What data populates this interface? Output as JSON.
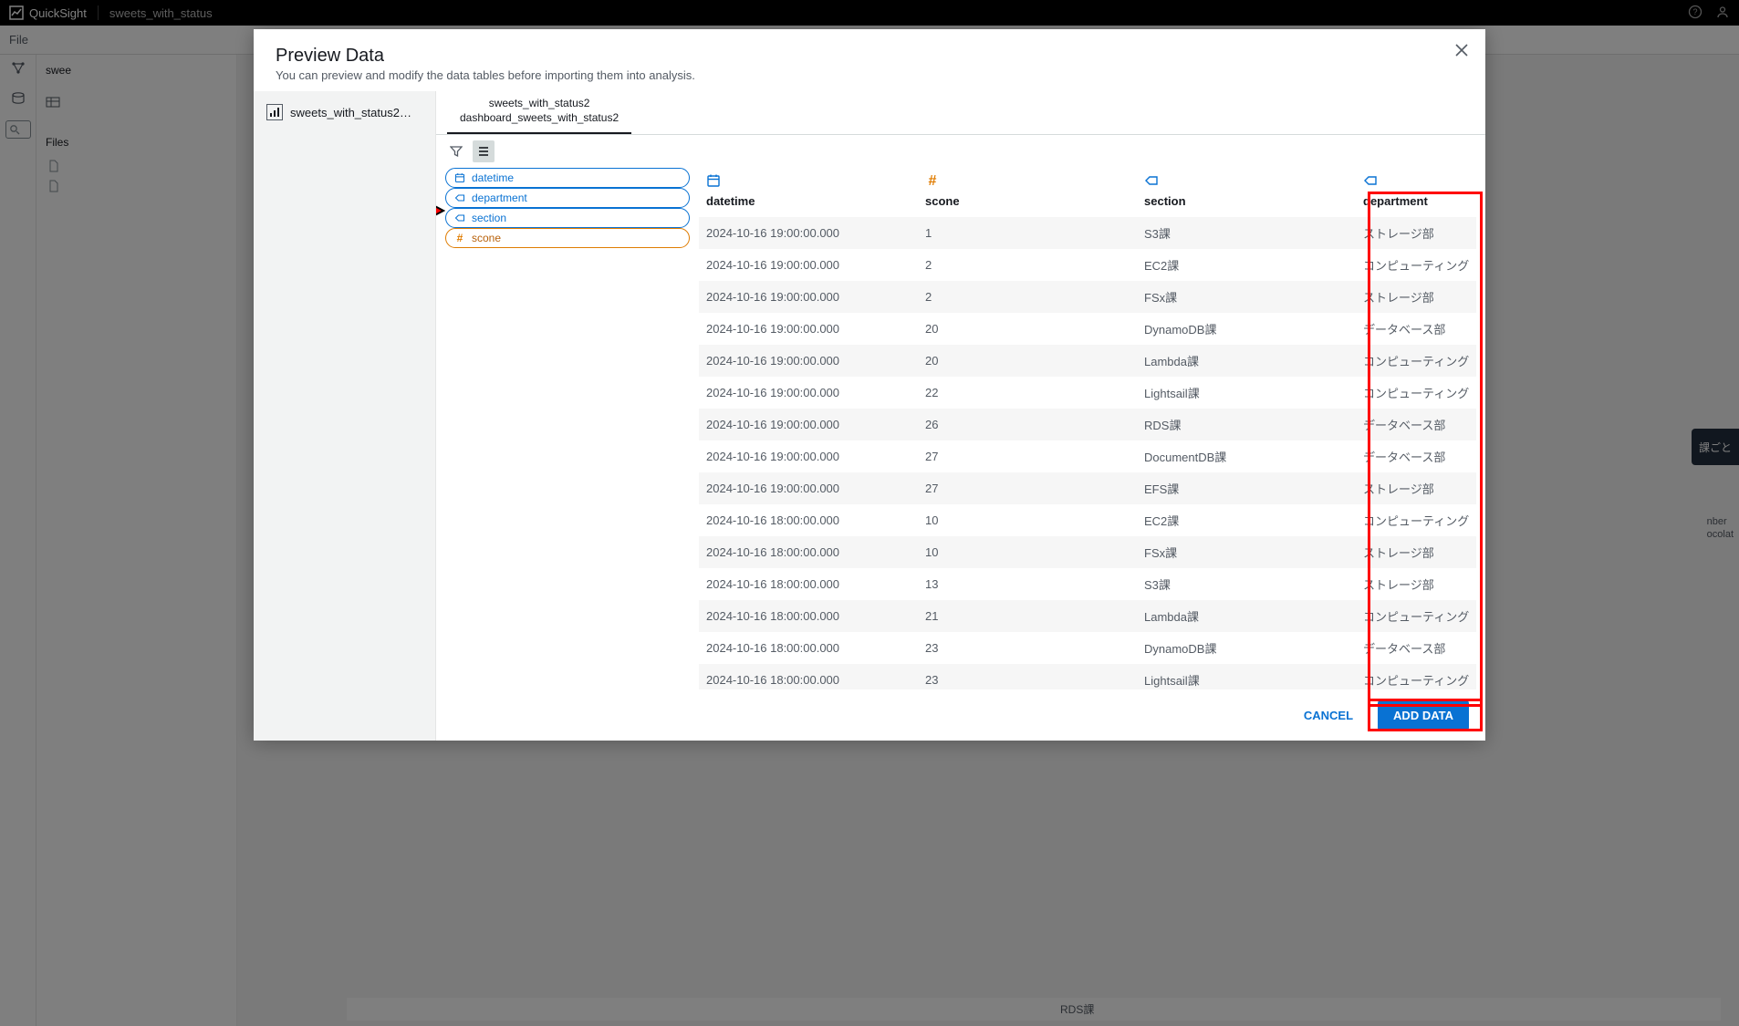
{
  "topbar": {
    "brand": "QuickSight",
    "doc": "sweets_with_status"
  },
  "subbar": {
    "file_label": "File"
  },
  "bg_sidebar": {
    "title_peek": "swee",
    "files_header": "Files",
    "files": [
      "",
      ""
    ]
  },
  "modal": {
    "title": "Preview Data",
    "subtitle": "You can preview and modify the data tables before importing them into analysis.",
    "close_aria": "Close",
    "left_ds_label": "sweets_with_status2…",
    "tab": {
      "line1": "sweets_with_status2",
      "line2": "dashboard_sweets_with_status2"
    },
    "pills": [
      {
        "kind": "date",
        "label": "datetime"
      },
      {
        "kind": "dim",
        "label": "department"
      },
      {
        "kind": "dim",
        "label": "section"
      },
      {
        "kind": "meas",
        "label": "scone"
      }
    ],
    "columns": [
      {
        "key": "datetime",
        "type": "date",
        "label": "datetime"
      },
      {
        "key": "scone",
        "type": "number",
        "label": "scone"
      },
      {
        "key": "section",
        "type": "dim",
        "label": "section"
      },
      {
        "key": "department",
        "type": "dim",
        "label": "department"
      }
    ],
    "rows": [
      {
        "datetime": "2024-10-16 19:00:00.000",
        "scone": "1",
        "section": "S3課",
        "department": "ストレージ部"
      },
      {
        "datetime": "2024-10-16 19:00:00.000",
        "scone": "2",
        "section": "EC2課",
        "department": "コンピューティング"
      },
      {
        "datetime": "2024-10-16 19:00:00.000",
        "scone": "2",
        "section": "FSx課",
        "department": "ストレージ部"
      },
      {
        "datetime": "2024-10-16 19:00:00.000",
        "scone": "20",
        "section": "DynamoDB課",
        "department": "データベース部"
      },
      {
        "datetime": "2024-10-16 19:00:00.000",
        "scone": "20",
        "section": "Lambda課",
        "department": "コンピューティング"
      },
      {
        "datetime": "2024-10-16 19:00:00.000",
        "scone": "22",
        "section": "Lightsail課",
        "department": "コンピューティング"
      },
      {
        "datetime": "2024-10-16 19:00:00.000",
        "scone": "26",
        "section": "RDS課",
        "department": "データベース部"
      },
      {
        "datetime": "2024-10-16 19:00:00.000",
        "scone": "27",
        "section": "DocumentDB課",
        "department": "データベース部"
      },
      {
        "datetime": "2024-10-16 19:00:00.000",
        "scone": "27",
        "section": "EFS課",
        "department": "ストレージ部"
      },
      {
        "datetime": "2024-10-16 18:00:00.000",
        "scone": "10",
        "section": "EC2課",
        "department": "コンピューティング"
      },
      {
        "datetime": "2024-10-16 18:00:00.000",
        "scone": "10",
        "section": "FSx課",
        "department": "ストレージ部"
      },
      {
        "datetime": "2024-10-16 18:00:00.000",
        "scone": "13",
        "section": "S3課",
        "department": "ストレージ部"
      },
      {
        "datetime": "2024-10-16 18:00:00.000",
        "scone": "21",
        "section": "Lambda課",
        "department": "コンピューティング"
      },
      {
        "datetime": "2024-10-16 18:00:00.000",
        "scone": "23",
        "section": "DynamoDB課",
        "department": "データベース部"
      },
      {
        "datetime": "2024-10-16 18:00:00.000",
        "scone": "23",
        "section": "Lightsail課",
        "department": "コンピューティング"
      }
    ],
    "footer": {
      "cancel": "CANCEL",
      "add": "ADD DATA"
    }
  },
  "bg_peek": {
    "right_pill": "課ごと",
    "text1": "nber",
    "text2": "ocolat",
    "bottom_row": "RDS課"
  }
}
